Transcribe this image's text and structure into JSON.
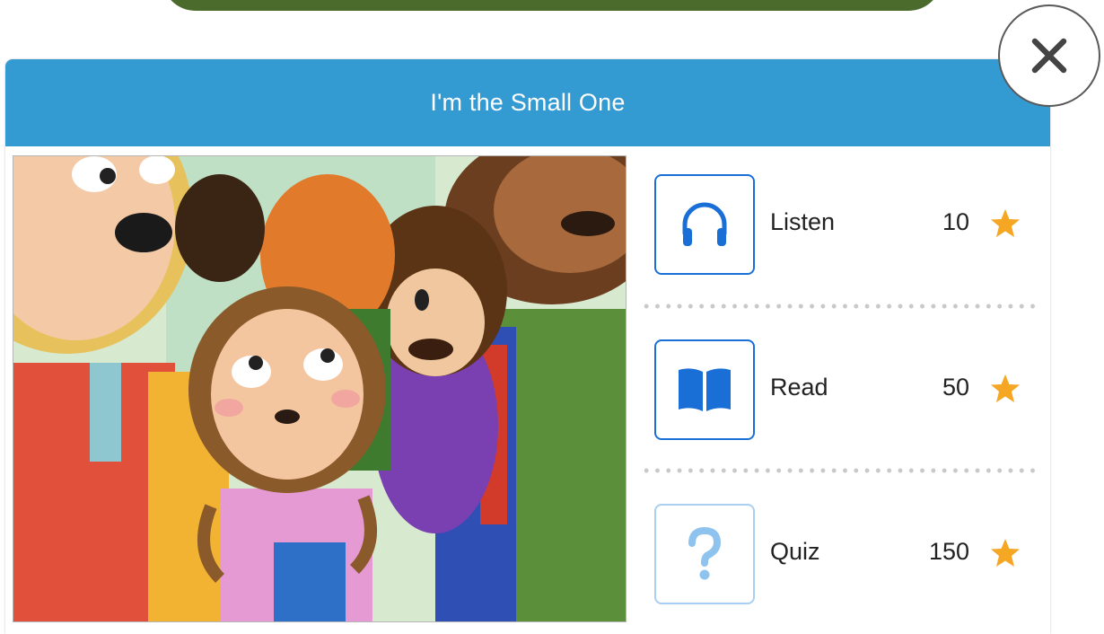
{
  "book": {
    "title": "I'm the Small One"
  },
  "close": {
    "icon": "close-x-icon"
  },
  "activities": [
    {
      "label": "Listen",
      "points": "10",
      "icon": "headphones-icon",
      "enabled": true
    },
    {
      "label": "Read",
      "points": "50",
      "icon": "open-book-icon",
      "enabled": true
    },
    {
      "label": "Quiz",
      "points": "150",
      "icon": "question-mark-icon",
      "enabled": false
    }
  ],
  "colors": {
    "header": "#339ad2",
    "accent_blue": "#1a6fd6",
    "quiz_blue": "#8ec3ef",
    "star": "#f5a623",
    "banner": "#4a6b2b"
  }
}
